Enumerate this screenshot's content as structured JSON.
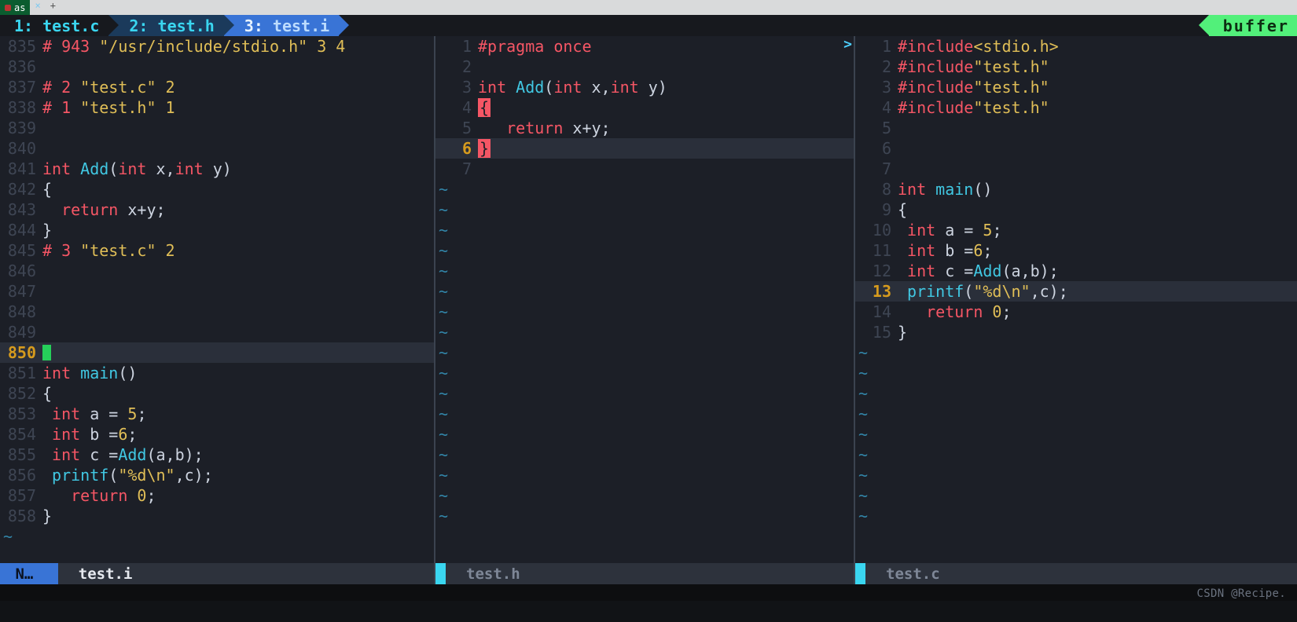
{
  "os_tab": {
    "title": "as",
    "close_glyph": "×",
    "add_glyph": "+"
  },
  "tabline": {
    "tabs": [
      {
        "index": "1:",
        "name": "test.c"
      },
      {
        "index": "2:",
        "name": "test.h"
      },
      {
        "index": "3:",
        "name": "test.i"
      }
    ],
    "right_badge": "buffer"
  },
  "panes": [
    {
      "id": "left",
      "filename": "test.i",
      "mode": "N…",
      "active": true,
      "cursor_line": 850,
      "lines": [
        {
          "n": 835,
          "tokens": [
            [
              "pre",
              "# 943 "
            ],
            [
              "str",
              "\"/usr/include/stdio.h\""
            ],
            [
              "macro",
              " 3 4"
            ]
          ]
        },
        {
          "n": 836,
          "tokens": []
        },
        {
          "n": 837,
          "tokens": [
            [
              "pre",
              "# 2 "
            ],
            [
              "str",
              "\"test.c\""
            ],
            [
              "macro",
              " 2"
            ]
          ]
        },
        {
          "n": 838,
          "tokens": [
            [
              "pre",
              "# 1 "
            ],
            [
              "str",
              "\"test.h\""
            ],
            [
              "macro",
              " 1"
            ]
          ]
        },
        {
          "n": 839,
          "tokens": []
        },
        {
          "n": 840,
          "tokens": []
        },
        {
          "n": 841,
          "tokens": [
            [
              "type",
              "int "
            ],
            [
              "fn",
              "Add"
            ],
            [
              "id",
              "("
            ],
            [
              "type",
              "int"
            ],
            [
              "id",
              " x,"
            ],
            [
              "type",
              "int"
            ],
            [
              "id",
              " y)"
            ]
          ]
        },
        {
          "n": 842,
          "tokens": [
            [
              "id",
              "{"
            ]
          ]
        },
        {
          "n": 843,
          "tokens": [
            [
              "id",
              "  "
            ],
            [
              "key",
              "return"
            ],
            [
              "id",
              " x+y;"
            ]
          ]
        },
        {
          "n": 844,
          "tokens": [
            [
              "id",
              "}"
            ]
          ]
        },
        {
          "n": 845,
          "tokens": [
            [
              "pre",
              "# 3 "
            ],
            [
              "str",
              "\"test.c\""
            ],
            [
              "macro",
              " 2"
            ]
          ]
        },
        {
          "n": 846,
          "tokens": []
        },
        {
          "n": 847,
          "tokens": []
        },
        {
          "n": 848,
          "tokens": []
        },
        {
          "n": 849,
          "tokens": []
        },
        {
          "n": 850,
          "tokens": [
            [
              "cursor",
              ""
            ]
          ],
          "current": true
        },
        {
          "n": 851,
          "tokens": [
            [
              "type",
              "int "
            ],
            [
              "fn",
              "main"
            ],
            [
              "id",
              "()"
            ]
          ]
        },
        {
          "n": 852,
          "tokens": [
            [
              "id",
              "{"
            ]
          ]
        },
        {
          "n": 853,
          "tokens": [
            [
              "id",
              " "
            ],
            [
              "type",
              "int"
            ],
            [
              "id",
              " a = "
            ],
            [
              "num",
              "5"
            ],
            [
              "id",
              ";"
            ]
          ]
        },
        {
          "n": 854,
          "tokens": [
            [
              "id",
              " "
            ],
            [
              "type",
              "int"
            ],
            [
              "id",
              " b ="
            ],
            [
              "num",
              "6"
            ],
            [
              "id",
              ";"
            ]
          ]
        },
        {
          "n": 855,
          "tokens": [
            [
              "id",
              " "
            ],
            [
              "type",
              "int"
            ],
            [
              "id",
              " c ="
            ],
            [
              "fn",
              "Add"
            ],
            [
              "id",
              "(a,b);"
            ]
          ]
        },
        {
          "n": 856,
          "tokens": [
            [
              "id",
              " "
            ],
            [
              "fn",
              "printf"
            ],
            [
              "id",
              "("
            ],
            [
              "str",
              "\"%d\\n\""
            ],
            [
              "id",
              ",c);"
            ]
          ]
        },
        {
          "n": 857,
          "tokens": [
            [
              "id",
              "   "
            ],
            [
              "key",
              "return"
            ],
            [
              "id",
              " "
            ],
            [
              "num",
              "0"
            ],
            [
              "id",
              ";"
            ]
          ]
        },
        {
          "n": 858,
          "tokens": [
            [
              "id",
              "}"
            ]
          ]
        }
      ],
      "tildes": 1
    },
    {
      "id": "middle",
      "filename": "test.h",
      "active": false,
      "cursor_line": 6,
      "scroll_top_indicator": ">",
      "lines": [
        {
          "n": 1,
          "tokens": [
            [
              "pre",
              "#pragma once"
            ]
          ]
        },
        {
          "n": 2,
          "tokens": []
        },
        {
          "n": 3,
          "tokens": [
            [
              "type",
              "int "
            ],
            [
              "fn",
              "Add"
            ],
            [
              "id",
              "("
            ],
            [
              "type",
              "int"
            ],
            [
              "id",
              " x,"
            ],
            [
              "type",
              "int"
            ],
            [
              "id",
              " y)"
            ]
          ]
        },
        {
          "n": 4,
          "tokens": [
            [
              "hlbrace",
              "{"
            ]
          ]
        },
        {
          "n": 5,
          "tokens": [
            [
              "id",
              "   "
            ],
            [
              "key",
              "return"
            ],
            [
              "id",
              " x+y;"
            ]
          ]
        },
        {
          "n": 6,
          "tokens": [
            [
              "hlbrace",
              "}"
            ]
          ],
          "current": true
        },
        {
          "n": 7,
          "tokens": []
        }
      ],
      "tildes": 17
    },
    {
      "id": "right",
      "filename": "test.c",
      "active": false,
      "cursor_line": 13,
      "lines": [
        {
          "n": 1,
          "tokens": [
            [
              "pre",
              "#include"
            ],
            [
              "str",
              "<stdio.h>"
            ]
          ]
        },
        {
          "n": 2,
          "tokens": [
            [
              "pre",
              "#include"
            ],
            [
              "str",
              "\"test.h\""
            ]
          ]
        },
        {
          "n": 3,
          "tokens": [
            [
              "pre",
              "#include"
            ],
            [
              "str",
              "\"test.h\""
            ]
          ]
        },
        {
          "n": 4,
          "tokens": [
            [
              "pre",
              "#include"
            ],
            [
              "str",
              "\"test.h\""
            ]
          ]
        },
        {
          "n": 5,
          "tokens": []
        },
        {
          "n": 6,
          "tokens": []
        },
        {
          "n": 7,
          "tokens": []
        },
        {
          "n": 8,
          "tokens": [
            [
              "type",
              "int "
            ],
            [
              "fn",
              "main"
            ],
            [
              "id",
              "()"
            ]
          ]
        },
        {
          "n": 9,
          "tokens": [
            [
              "id",
              "{"
            ]
          ]
        },
        {
          "n": 10,
          "tokens": [
            [
              "id",
              " "
            ],
            [
              "type",
              "int"
            ],
            [
              "id",
              " a = "
            ],
            [
              "num",
              "5"
            ],
            [
              "id",
              ";"
            ]
          ]
        },
        {
          "n": 11,
          "tokens": [
            [
              "id",
              " "
            ],
            [
              "type",
              "int"
            ],
            [
              "id",
              " b ="
            ],
            [
              "num",
              "6"
            ],
            [
              "id",
              ";"
            ]
          ]
        },
        {
          "n": 12,
          "tokens": [
            [
              "id",
              " "
            ],
            [
              "type",
              "int"
            ],
            [
              "id",
              " c ="
            ],
            [
              "fn",
              "Add"
            ],
            [
              "id",
              "(a,b);"
            ]
          ]
        },
        {
          "n": 13,
          "tokens": [
            [
              "id",
              " "
            ],
            [
              "fn",
              "printf"
            ],
            [
              "id",
              "("
            ],
            [
              "str",
              "\"%d\\n\""
            ],
            [
              "id",
              ",c);"
            ]
          ],
          "current": true
        },
        {
          "n": 14,
          "tokens": [
            [
              "id",
              "   "
            ],
            [
              "key",
              "return"
            ],
            [
              "id",
              " "
            ],
            [
              "num",
              "0"
            ],
            [
              "id",
              ";"
            ]
          ]
        },
        {
          "n": 15,
          "tokens": [
            [
              "id",
              "}"
            ]
          ]
        }
      ],
      "tildes": 9
    }
  ],
  "command_bar": "",
  "watermark": "CSDN @Recipe.",
  "pane_widths": [
    554,
    534,
    562
  ]
}
